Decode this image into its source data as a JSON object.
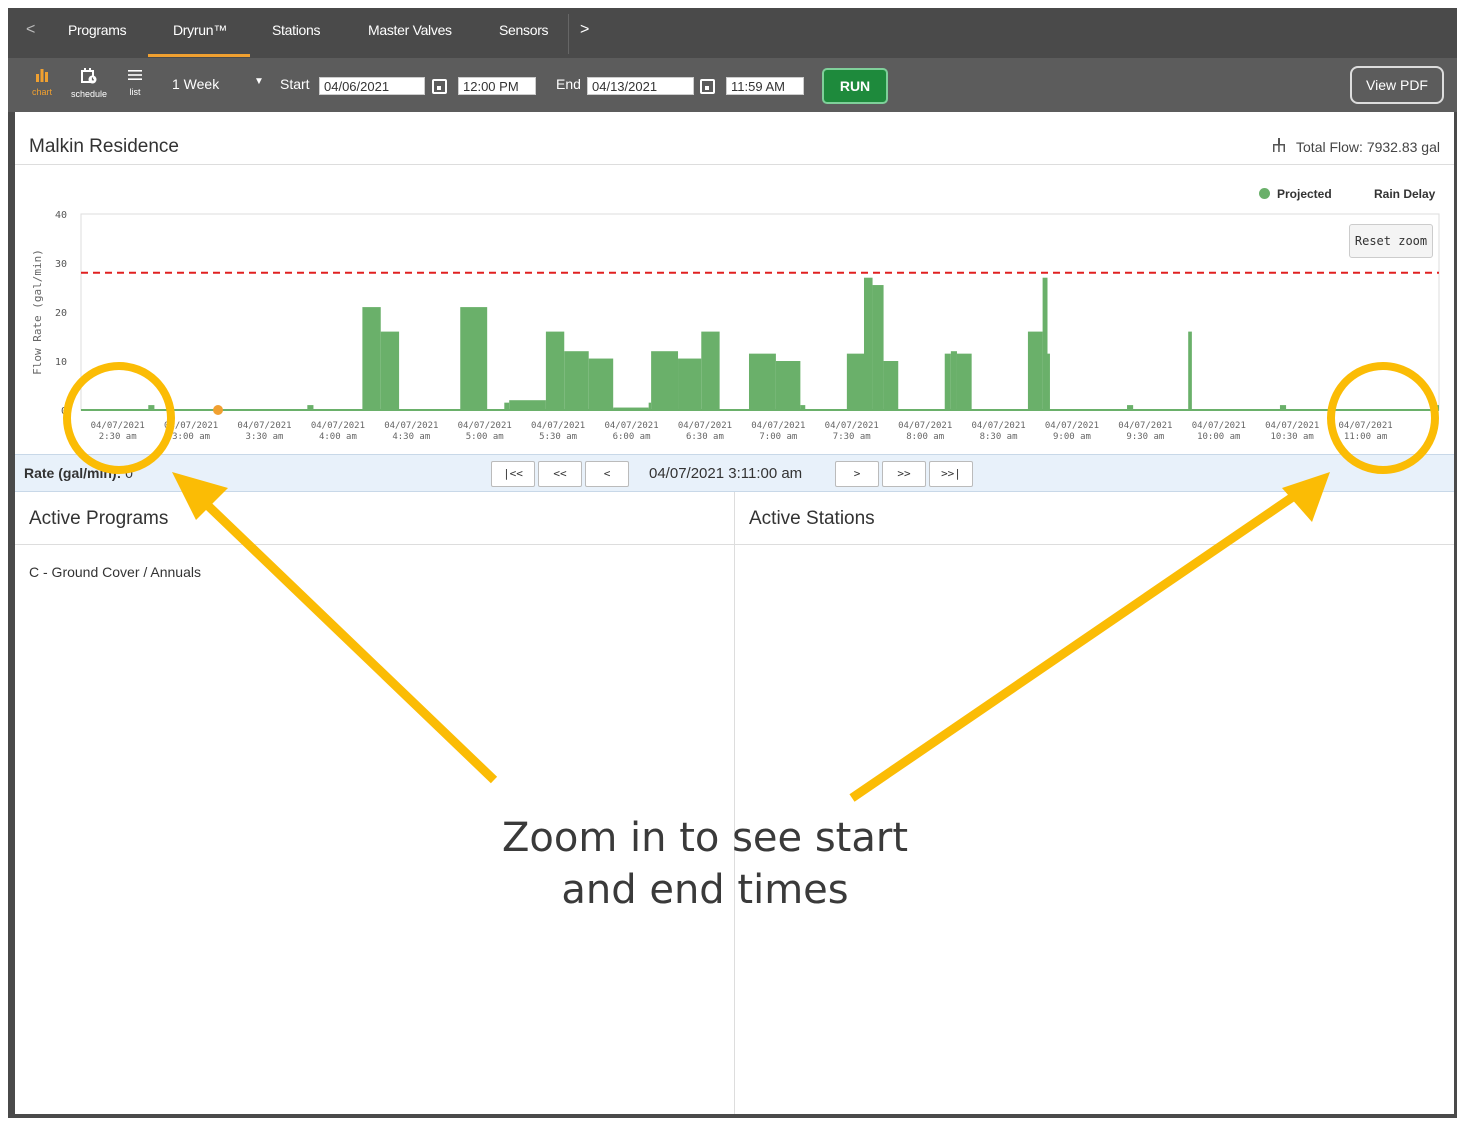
{
  "tabs": {
    "prev_arrow": "<",
    "next_arrow": ">",
    "items": [
      {
        "label": "Programs"
      },
      {
        "label": "Dryrun™"
      },
      {
        "label": "Stations"
      },
      {
        "label": "Master Valves"
      },
      {
        "label": "Sensors"
      }
    ],
    "active": "Dryrun™"
  },
  "toolbar": {
    "views": [
      {
        "label": "chart",
        "icon": "bar-chart-icon"
      },
      {
        "label": "schedule",
        "icon": "calendar-clock-icon"
      },
      {
        "label": "list",
        "icon": "list-icon"
      }
    ],
    "period": "1 Week",
    "start_label": "Start",
    "start_date": "04/06/2021",
    "start_time": "12:00 PM",
    "end_label": "End",
    "end_date": "04/13/2021",
    "end_time": "11:59 AM",
    "run_label": "RUN",
    "pdf_label": "View PDF"
  },
  "site": {
    "name": "Malkin Residence",
    "total_flow": "Total Flow: 7932.83 gal"
  },
  "legend": {
    "projected": "Projected",
    "rain_delay": "Rain Delay"
  },
  "reset_zoom": "Reset zoom",
  "colors": {
    "bar": "#6ab06a",
    "limit_line": "#e02020",
    "marker": "#f0a030",
    "annotation": "#fbbc05"
  },
  "chart_data": {
    "type": "bar",
    "ylabel": "Flow Rate (gal/min)",
    "ylim": [
      0,
      40
    ],
    "yticks": [
      0,
      10,
      20,
      30,
      40
    ],
    "grid": false,
    "legend_position": "top-right",
    "limit_line": 28,
    "x_start": "2:15 am",
    "x_end": "11:30 am",
    "tick_labels": [
      {
        "date": "04/07/2021",
        "time": "2:30 am",
        "minutes": 150
      },
      {
        "date": "04/07/2021",
        "time": "3:00 am",
        "minutes": 180
      },
      {
        "date": "04/07/2021",
        "time": "3:30 am",
        "minutes": 210
      },
      {
        "date": "04/07/2021",
        "time": "4:00 am",
        "minutes": 240
      },
      {
        "date": "04/07/2021",
        "time": "4:30 am",
        "minutes": 270
      },
      {
        "date": "04/07/2021",
        "time": "5:00 am",
        "minutes": 300
      },
      {
        "date": "04/07/2021",
        "time": "5:30 am",
        "minutes": 330
      },
      {
        "date": "04/07/2021",
        "time": "6:00 am",
        "minutes": 360
      },
      {
        "date": "04/07/2021",
        "time": "6:30 am",
        "minutes": 390
      },
      {
        "date": "04/07/2021",
        "time": "7:00 am",
        "minutes": 420
      },
      {
        "date": "04/07/2021",
        "time": "7:30 am",
        "minutes": 450
      },
      {
        "date": "04/07/2021",
        "time": "8:00 am",
        "minutes": 480
      },
      {
        "date": "04/07/2021",
        "time": "8:30 am",
        "minutes": 510
      },
      {
        "date": "04/07/2021",
        "time": "9:00 am",
        "minutes": 540
      },
      {
        "date": "04/07/2021",
        "time": "9:30 am",
        "minutes": 570
      },
      {
        "date": "04/07/2021",
        "time": "10:00 am",
        "minutes": 600
      },
      {
        "date": "04/07/2021",
        "time": "10:30 am",
        "minutes": 630
      },
      {
        "date": "04/07/2021",
        "time": "11:00 am",
        "minutes": 660
      }
    ],
    "cursor_minutes": 191,
    "series": [
      {
        "name": "Projected",
        "segments": [
          {
            "start": 162.5,
            "end": 165.0,
            "value": 1
          },
          {
            "start": 227.5,
            "end": 230.0,
            "value": 1
          },
          {
            "start": 250.0,
            "end": 257.5,
            "value": 21
          },
          {
            "start": 257.5,
            "end": 265.0,
            "value": 16
          },
          {
            "start": 290.0,
            "end": 301.0,
            "value": 21
          },
          {
            "start": 308.0,
            "end": 310.0,
            "value": 1.5
          },
          {
            "start": 310.0,
            "end": 325.0,
            "value": 2
          },
          {
            "start": 325.0,
            "end": 332.5,
            "value": 16
          },
          {
            "start": 332.5,
            "end": 342.5,
            "value": 12
          },
          {
            "start": 342.5,
            "end": 352.5,
            "value": 10.5
          },
          {
            "start": 352.5,
            "end": 367.0,
            "value": 0.5
          },
          {
            "start": 367.0,
            "end": 368.0,
            "value": 1.5
          },
          {
            "start": 368.0,
            "end": 379.0,
            "value": 12
          },
          {
            "start": 379.0,
            "end": 388.5,
            "value": 10.5
          },
          {
            "start": 388.5,
            "end": 396.0,
            "value": 16
          },
          {
            "start": 408.0,
            "end": 419.0,
            "value": 11.5
          },
          {
            "start": 419.0,
            "end": 429.0,
            "value": 10
          },
          {
            "start": 429.0,
            "end": 431.0,
            "value": 1
          },
          {
            "start": 448.0,
            "end": 455.0,
            "value": 11.5
          },
          {
            "start": 455.0,
            "end": 458.5,
            "value": 27
          },
          {
            "start": 458.5,
            "end": 463.0,
            "value": 25.5
          },
          {
            "start": 463.0,
            "end": 469.0,
            "value": 10
          },
          {
            "start": 488.0,
            "end": 490.5,
            "value": 11.5
          },
          {
            "start": 490.5,
            "end": 493.0,
            "value": 12
          },
          {
            "start": 493.0,
            "end": 499.0,
            "value": 11.5
          },
          {
            "start": 522.0,
            "end": 528.0,
            "value": 16
          },
          {
            "start": 528.0,
            "end": 530.0,
            "value": 27
          },
          {
            "start": 530.0,
            "end": 531.0,
            "value": 11.5
          },
          {
            "start": 562.5,
            "end": 565.0,
            "value": 1
          },
          {
            "start": 587.5,
            "end": 589.0,
            "value": 16
          },
          {
            "start": 625.0,
            "end": 627.5,
            "value": 1
          },
          {
            "start": 687.5,
            "end": 690.0,
            "value": 1
          }
        ]
      }
    ]
  },
  "navbar": {
    "rate_label": "Rate (gal/min):",
    "rate_value": "0",
    "buttons": [
      "|<<",
      "<<",
      "<",
      ">",
      ">>",
      ">>|"
    ],
    "current_time": "04/07/2021 3:11:00 am"
  },
  "columns": {
    "programs_title": "Active Programs",
    "stations_title": "Active Stations",
    "programs": [
      "C - Ground Cover / Annuals"
    ]
  },
  "annotation": {
    "line1": "Zoom in to see start",
    "line2": "and end times"
  }
}
